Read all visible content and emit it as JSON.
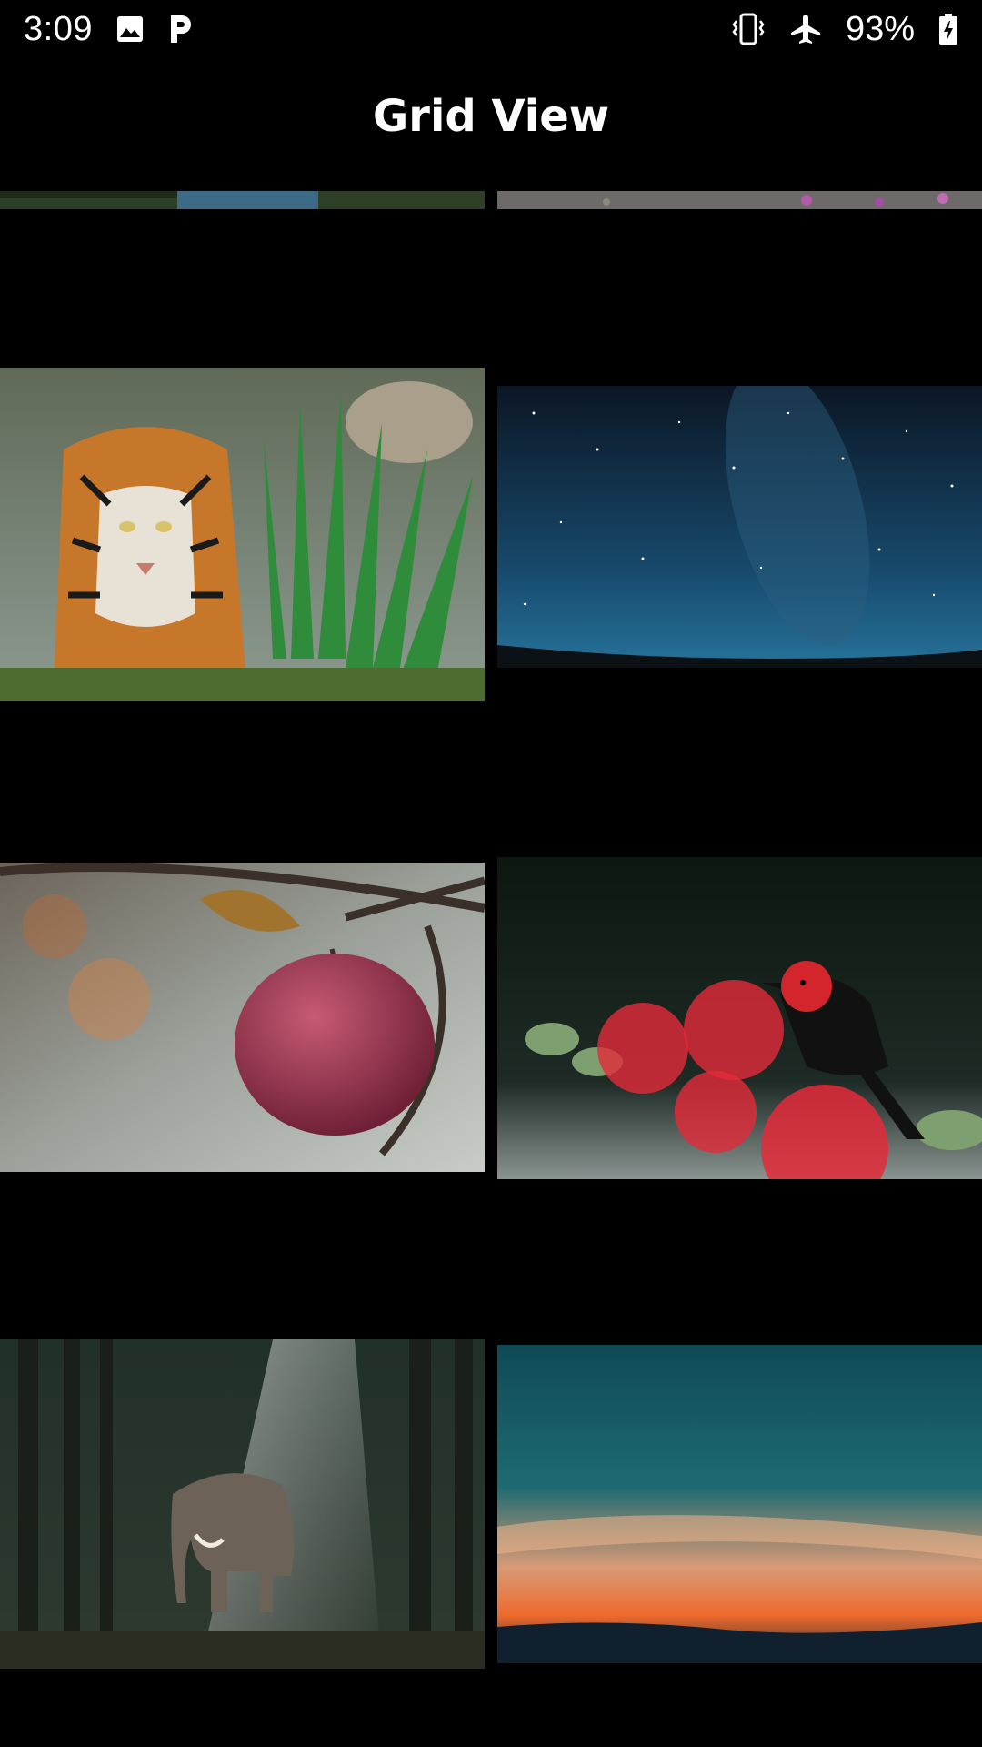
{
  "status_bar": {
    "time": "3:09",
    "battery_percent": "93%",
    "icons_left": [
      "image-icon",
      "parking-icon"
    ],
    "icons_right": [
      "vibrate-icon",
      "airplane-mode-icon",
      "battery-charging-icon"
    ]
  },
  "header": {
    "title": "Grid View"
  },
  "grid": {
    "columns": 2,
    "images": [
      {
        "name": "lake-forest"
      },
      {
        "name": "flower-field"
      },
      {
        "name": "tiger"
      },
      {
        "name": "night-sky"
      },
      {
        "name": "apple"
      },
      {
        "name": "red-bird"
      },
      {
        "name": "elephant"
      },
      {
        "name": "sunset"
      }
    ]
  },
  "colors": {
    "background": "#000000",
    "text": "#ffffff"
  }
}
